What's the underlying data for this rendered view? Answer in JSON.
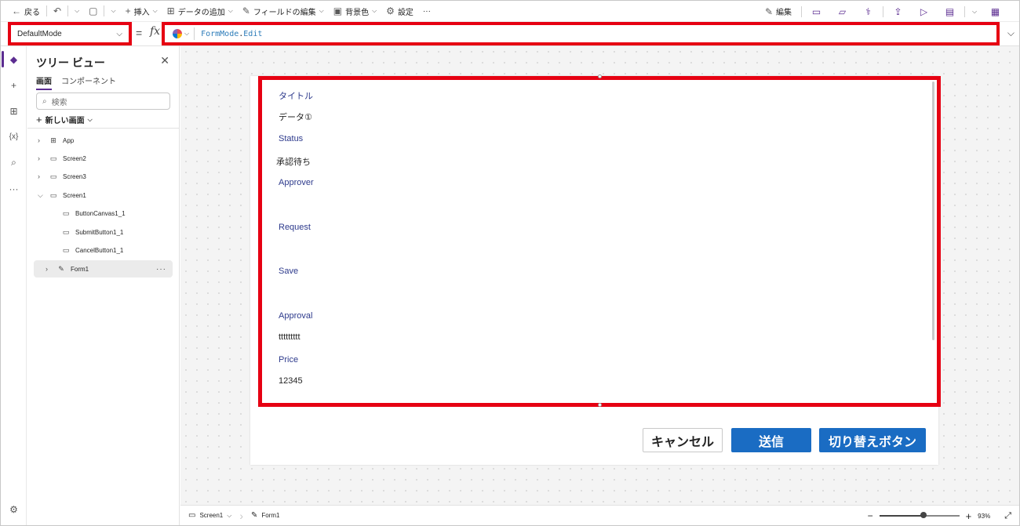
{
  "toolbar": {
    "back": "戻る",
    "insert": "挿入",
    "add_data": "データの追加",
    "edit_fields": "フィールドの編集",
    "background": "背景色",
    "settings": "設定",
    "more": "···",
    "edit": "編集"
  },
  "formula_bar": {
    "property": "DefaultMode",
    "equals": "=",
    "fx": "fx",
    "formula_object": "FormMode",
    "formula_dot": ".",
    "formula_member": "Edit"
  },
  "tree": {
    "title": "ツリー ビュー",
    "tabs": [
      "画面",
      "コンポーネント"
    ],
    "search_placeholder": "検索",
    "new_screen": "新しい画面",
    "nodes": {
      "app": "App",
      "screen2": "Screen2",
      "screen3": "Screen3",
      "screen1": "Screen1",
      "button_canvas": "ButtonCanvas1_1",
      "submit_button": "SubmitButton1_1",
      "cancel_button": "CancelButton1_1",
      "form": "Form1"
    }
  },
  "form": {
    "fields": [
      {
        "label": "タイトル",
        "value": "データ①"
      },
      {
        "label": "Status",
        "value": "承認待ち"
      },
      {
        "label": "Approver",
        "value": ""
      },
      {
        "label": "Request",
        "value": ""
      },
      {
        "label": "Save",
        "value": ""
      },
      {
        "label": "Approval",
        "value": "ttttttttt"
      },
      {
        "label": "Price",
        "value": "12345"
      }
    ]
  },
  "buttons": {
    "cancel": "キャンセル",
    "submit": "送信",
    "toggle": "切り替えボタン"
  },
  "statusbar": {
    "screen": "Screen1",
    "control": "Form1",
    "zoom": "93%",
    "zoom_level": 0.93
  },
  "colors": {
    "highlight": "#e60012",
    "accent": "#5c2d91",
    "button": "#1a6cc3",
    "label": "#2d3a8c"
  }
}
